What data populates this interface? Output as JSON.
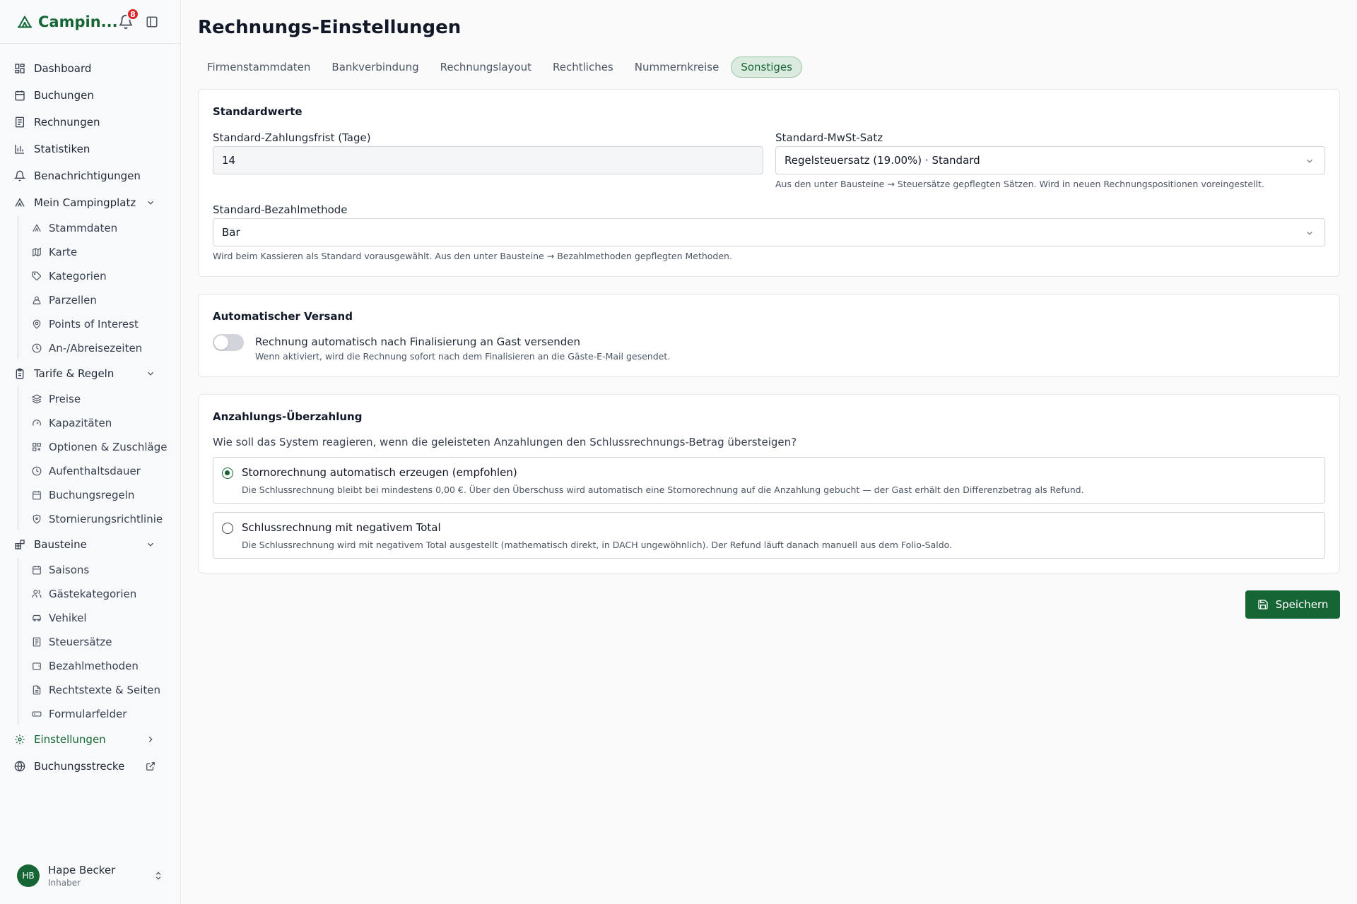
{
  "app": {
    "name": "Campin...",
    "notification_count": "8"
  },
  "nav": {
    "dashboard": "Dashboard",
    "bookings": "Buchungen",
    "invoices": "Rechnungen",
    "statistics": "Statistiken",
    "notifications": "Benachrichtigungen",
    "my_campsite": "Mein Campingplatz",
    "my_campsite_items": [
      "Stammdaten",
      "Karte",
      "Kategorien",
      "Parzellen",
      "Points of Interest",
      "An-/Abreisezeiten"
    ],
    "tariffs": "Tarife & Regeln",
    "tariffs_items": [
      "Preise",
      "Kapazitäten",
      "Optionen & Zuschläge",
      "Aufenthaltsdauer",
      "Buchungsregeln",
      "Stornierungsrichtlinie"
    ],
    "modules": "Bausteine",
    "modules_items": [
      "Saisons",
      "Gästekategorien",
      "Vehikel",
      "Steuersätze",
      "Bezahlmethoden",
      "Rechtstexte & Seiten",
      "Formularfelder"
    ],
    "settings": "Einstellungen",
    "booking_route": "Buchungsstrecke"
  },
  "user": {
    "initials": "HB",
    "name": "Hape Becker",
    "role": "Inhaber"
  },
  "page": {
    "title": "Rechnungs-Einstellungen",
    "tabs": [
      "Firmenstammdaten",
      "Bankverbindung",
      "Rechnungslayout",
      "Rechtliches",
      "Nummernkreise",
      "Sonstiges"
    ],
    "active_tab": "Sonstiges"
  },
  "defaults": {
    "title": "Standardwerte",
    "payment_term_label": "Standard-Zahlungsfrist (Tage)",
    "payment_term_value": "14",
    "vat_label": "Standard-MwSt-Satz",
    "vat_value": "Regelsteuersatz (19.00%) · Standard",
    "vat_hint": "Aus den unter Bausteine → Steuersätze gepflegten Sätzen. Wird in neuen Rechnungspositionen voreingestellt.",
    "payment_method_label": "Standard-Bezahlmethode",
    "payment_method_value": "Bar",
    "payment_method_hint": "Wird beim Kassieren als Standard vorausgewählt. Aus den unter Bausteine → Bezahlmethoden gepflegten Methoden."
  },
  "auto_send": {
    "title": "Automatischer Versand",
    "toggle_label": "Rechnung automatisch nach Finalisierung an Gast versenden",
    "toggle_hint": "Wenn aktiviert, wird die Rechnung sofort nach dem Finalisieren an die Gäste-E-Mail gesendet.",
    "enabled": false
  },
  "overpayment": {
    "title": "Anzahlungs-Überzahlung",
    "question": "Wie soll das System reagieren, wenn die geleisteten Anzahlungen den Schlussrechnungs-Betrag übersteigen?",
    "options": [
      {
        "title": "Stornorechnung automatisch erzeugen (empfohlen)",
        "desc": "Die Schlussrechnung bleibt bei mindestens 0,00 €. Über den Überschuss wird automatisch eine Stornorechnung auf die Anzahlung gebucht — der Gast erhält den Differenzbetrag als Refund.",
        "checked": true
      },
      {
        "title": "Schlussrechnung mit negativem Total",
        "desc": "Die Schlussrechnung wird mit negativem Total ausgestellt (mathematisch direkt, in DACH ungewöhnlich). Der Refund läuft danach manuell aus dem Folio-Saldo.",
        "checked": false
      }
    ]
  },
  "save_label": "Speichern",
  "colors": {
    "brand": "#166534",
    "badge": "#dc2626"
  }
}
